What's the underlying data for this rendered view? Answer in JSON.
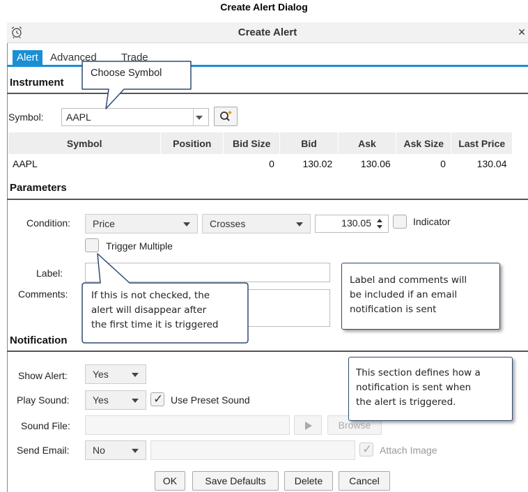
{
  "document": {
    "title": "Create Alert Dialog"
  },
  "dialog": {
    "title": "Create Alert",
    "close": "×"
  },
  "tabs": [
    {
      "label": "Alert",
      "active": true
    },
    {
      "label": "Advanced",
      "active": false
    },
    {
      "label": "Trade",
      "active": false
    }
  ],
  "instrument": {
    "heading": "Instrument",
    "symbol_label": "Symbol:",
    "symbol_value": "AAPL",
    "table": {
      "headers": [
        "Symbol",
        "Position",
        "Bid Size",
        "Bid",
        "Ask",
        "Ask Size",
        "Last Price"
      ],
      "rows": [
        [
          "AAPL",
          "",
          "0",
          "130.02",
          "130.06",
          "0",
          "130.04"
        ]
      ]
    }
  },
  "parameters": {
    "heading": "Parameters",
    "condition_label": "Condition:",
    "condition_type": "Price",
    "condition_operator": "Crosses",
    "condition_value": "130.05",
    "indicator_label": "Indicator",
    "indicator_checked": false,
    "trigger_multiple_label": "Trigger Multiple",
    "trigger_multiple_checked": false,
    "label_label": "Label:",
    "label_value": "",
    "comments_label": "Comments:",
    "comments_value": ""
  },
  "notifications": {
    "heading": "Notification",
    "show_alert_label": "Show Alert:",
    "show_alert_value": "Yes",
    "play_sound_label": "Play Sound:",
    "play_sound_value": "Yes",
    "use_preset_label": "Use Preset Sound",
    "use_preset_checked": true,
    "sound_file_label": "Sound File:",
    "browse_label": "Browse",
    "send_email_label": "Send Email:",
    "send_email_value": "No",
    "attach_image_label": "Attach Image",
    "attach_image_checked": true
  },
  "buttons": {
    "ok": "OK",
    "save_defaults": "Save Defaults",
    "delete": "Delete",
    "cancel": "Cancel"
  },
  "callouts": {
    "choose_symbol": "Choose Symbol",
    "trigger_note": [
      "If this is not checked, the",
      "alert will disappear after",
      "the first time it is triggered"
    ],
    "label_note": [
      "Label and comments will",
      "be included if an email",
      "notification is sent"
    ],
    "section_note": [
      "This section defines how a",
      "notification is sent when",
      "the alert is triggered."
    ]
  },
  "colors": {
    "accent": "#1a8fd6",
    "callout_border": "#2e4a72"
  }
}
